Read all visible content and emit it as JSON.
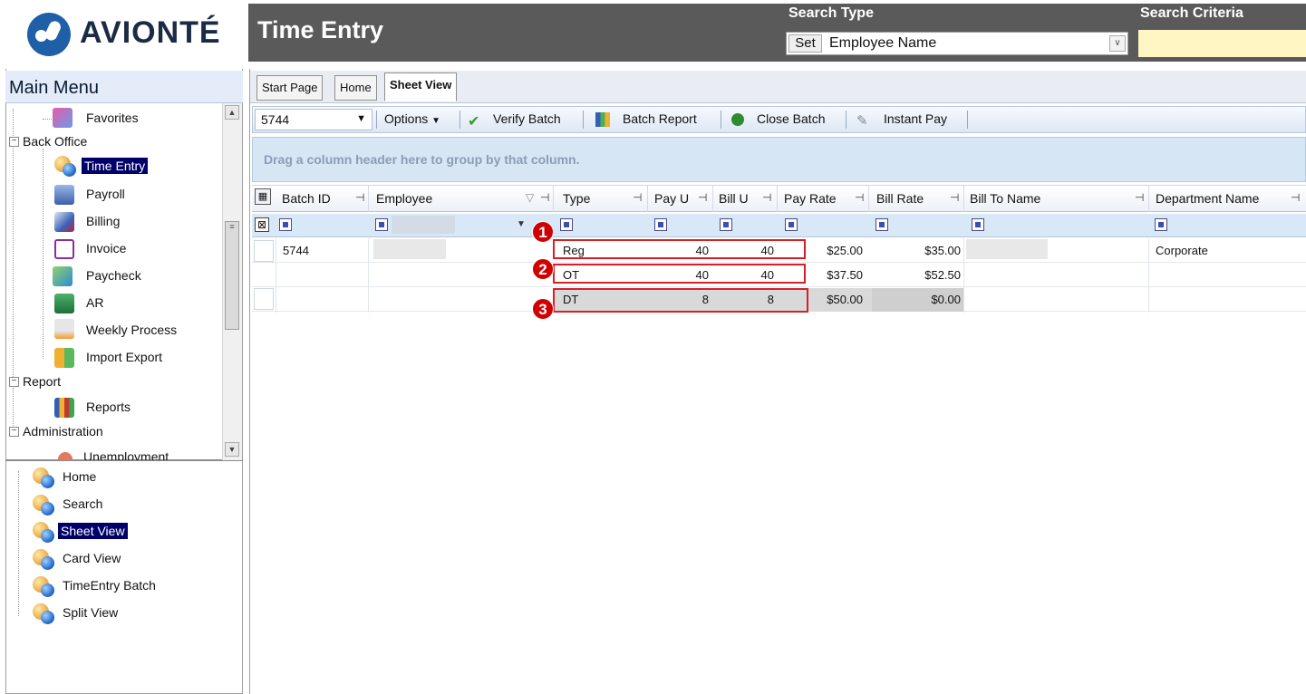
{
  "brand": {
    "name": "AVIONTÉ"
  },
  "header": {
    "title": "Time Entry",
    "search_type_label": "Search Type",
    "search_criteria_label": "Search Criteria",
    "set_button": "Set",
    "search_type_value": "Employee Name",
    "search_criteria_value": ""
  },
  "sidebar": {
    "title": "Main Menu",
    "tree": {
      "favorites": "Favorites",
      "back_office": "Back Office",
      "time_entry": "Time Entry",
      "payroll": "Payroll",
      "billing": "Billing",
      "invoice": "Invoice",
      "paycheck": "Paycheck",
      "ar": "AR",
      "weekly_process": "Weekly Process",
      "import_export": "Import Export",
      "report": "Report",
      "reports": "Reports",
      "administration": "Administration",
      "unemployment": "Unemployment"
    },
    "views": [
      "Home",
      "Search",
      "Sheet View",
      "Card View",
      "TimeEntry Batch",
      "Split View"
    ],
    "selected_view": "Sheet View"
  },
  "tabs": [
    "Start Page",
    "Home",
    "Sheet View"
  ],
  "active_tab": "Sheet View",
  "toolbar": {
    "batch_value": "5744",
    "options": "Options",
    "verify_batch": "Verify Batch",
    "batch_report": "Batch Report",
    "close_batch": "Close Batch",
    "instant_pay": "Instant Pay"
  },
  "group_hint": "Drag a column header here to group by that column.",
  "grid": {
    "columns": [
      "Batch ID",
      "Employee",
      "Type",
      "Pay U",
      "Bill U",
      "Pay Rate",
      "Bill Rate",
      "Bill To Name",
      "Department Name"
    ],
    "rows": [
      {
        "batch_id": "5744",
        "type": "Reg",
        "pay_u": "40",
        "bill_u": "40",
        "pay_rate": "$25.00",
        "bill_rate": "$35.00",
        "department": "Corporate"
      },
      {
        "batch_id": "",
        "type": "OT",
        "pay_u": "40",
        "bill_u": "40",
        "pay_rate": "$37.50",
        "bill_rate": "$52.50",
        "department": ""
      },
      {
        "batch_id": "",
        "type": "DT",
        "pay_u": "8",
        "bill_u": "8",
        "pay_rate": "$50.00",
        "bill_rate": "$0.00",
        "department": ""
      }
    ]
  },
  "callouts": [
    "1",
    "2",
    "3"
  ],
  "colors": {
    "accent": "#1f5fa8",
    "header_bg": "#5a5a5a",
    "highlight": "#d62026",
    "selection": "#00006a"
  }
}
